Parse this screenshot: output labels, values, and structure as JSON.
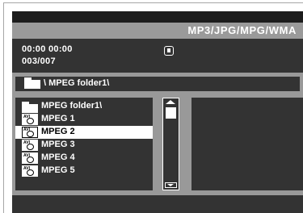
{
  "header": {
    "mode_title": "MP3/JPG/MPG/WMA"
  },
  "status": {
    "time": "00:00  00:00",
    "track": "003/007",
    "play_state_icon": "stop-icon"
  },
  "path": {
    "icon": "folder-icon",
    "label": "\\ MPEG folder1\\"
  },
  "file_list": {
    "items": [
      {
        "label": "MPEG folder1\\",
        "icon": "folder-icon",
        "selected": false
      },
      {
        "label": "MPEG 1",
        "icon": "avi-file-icon",
        "selected": false
      },
      {
        "label": "MPEG 2",
        "icon": "avi-file-icon",
        "selected": true
      },
      {
        "label": "MPEG 3",
        "icon": "avi-file-icon",
        "selected": false
      },
      {
        "label": "MPEG 4",
        "icon": "avi-file-icon",
        "selected": false
      },
      {
        "label": "MPEG 5",
        "icon": "avi-file-icon",
        "selected": false
      }
    ],
    "file_icon_tag": "AVI"
  },
  "colors": {
    "panel": "#333333",
    "background": "#999999",
    "highlight": "#ffffff",
    "text": "#ffffff"
  }
}
